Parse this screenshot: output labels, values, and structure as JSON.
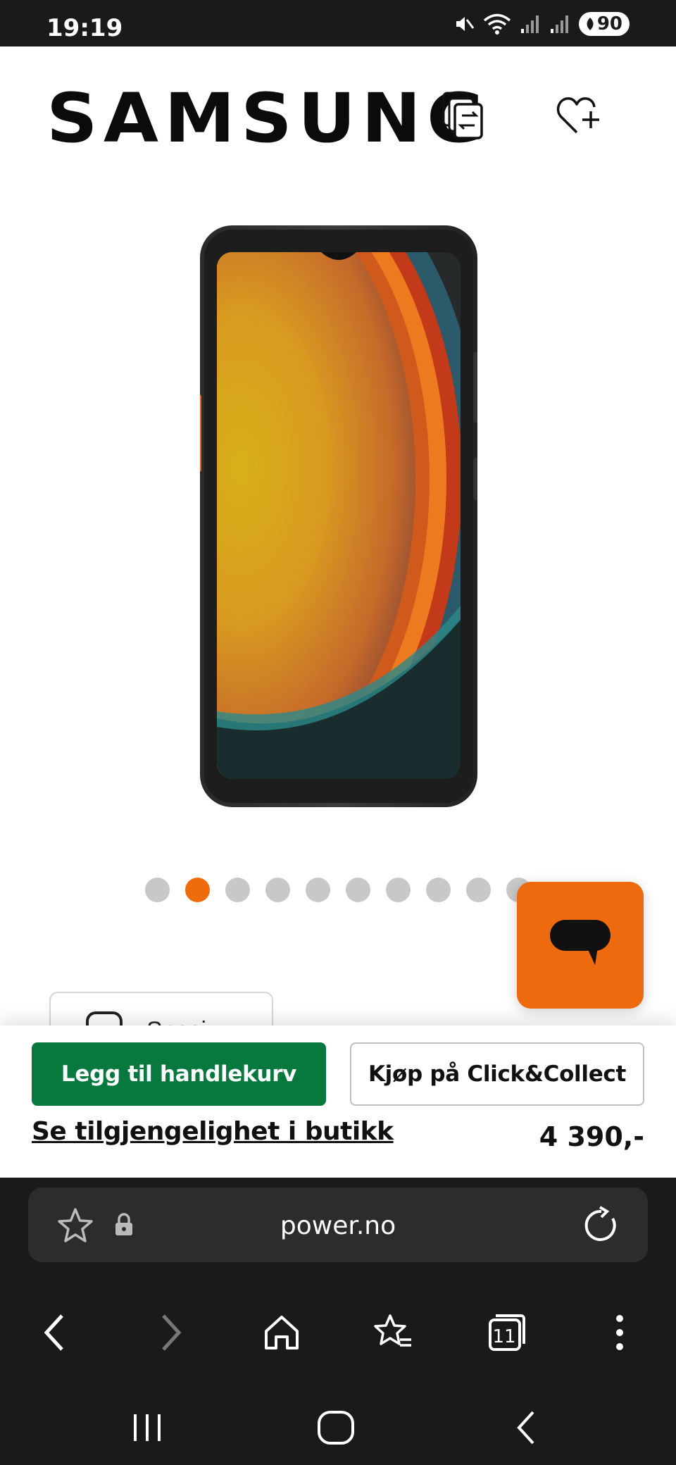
{
  "status_bar": {
    "time": "19:19",
    "battery": "90",
    "icons": [
      "mute-icon",
      "wifi-icon",
      "signal-icon",
      "signal-icon"
    ]
  },
  "header": {
    "brand": "SAMSUNG",
    "compare_icon": "compare-icon",
    "wishlist_icon": "heart-plus-icon"
  },
  "product": {
    "image_alt": "phone-product-image",
    "carousel": {
      "total": 10,
      "active_index": 1
    }
  },
  "partial_tab": {
    "label": "Spesi..."
  },
  "chat": {
    "icon": "chat-bubble-icon",
    "color": "#ee6a0e"
  },
  "buy_bar": {
    "add_to_cart": "Legg til handlekurv",
    "click_collect": "Kjøp på Click&Collect",
    "stock_link": "Se tilgjengelighet i butikk",
    "price": "4 390,-",
    "cart_color": "#08793e"
  },
  "browser": {
    "url": "power.no",
    "tab_count": "11",
    "nav_icons": [
      "back-icon",
      "forward-icon",
      "home-icon",
      "bookmarks-icon",
      "tabs-icon",
      "more-icon"
    ]
  },
  "system_nav": [
    "recents-icon",
    "home-icon",
    "back-icon"
  ]
}
